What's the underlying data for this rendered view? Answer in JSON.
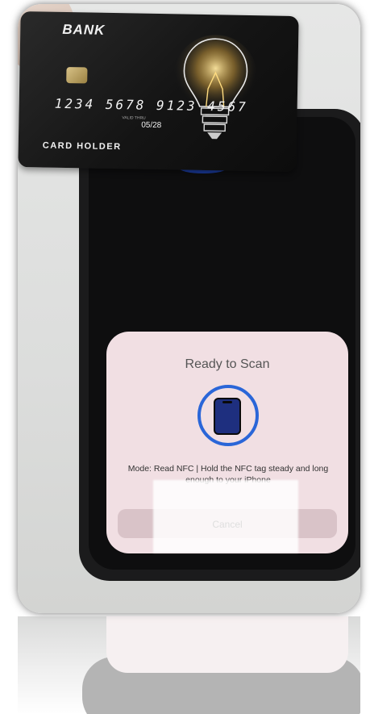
{
  "card": {
    "bank_name": "BANK",
    "number": "1234 5678 9123 4567",
    "valid_thru": "VALID THRU",
    "expiry": "05/28",
    "holder": "CARD HOLDER"
  },
  "nfc_sheet": {
    "title": "Ready to Scan",
    "message": "Mode: Read NFC | Hold the NFC tag steady and long enough to your iPhone",
    "cancel_label": "Cancel",
    "accent_color": "#2a66d8",
    "icon": "phone-icon"
  }
}
